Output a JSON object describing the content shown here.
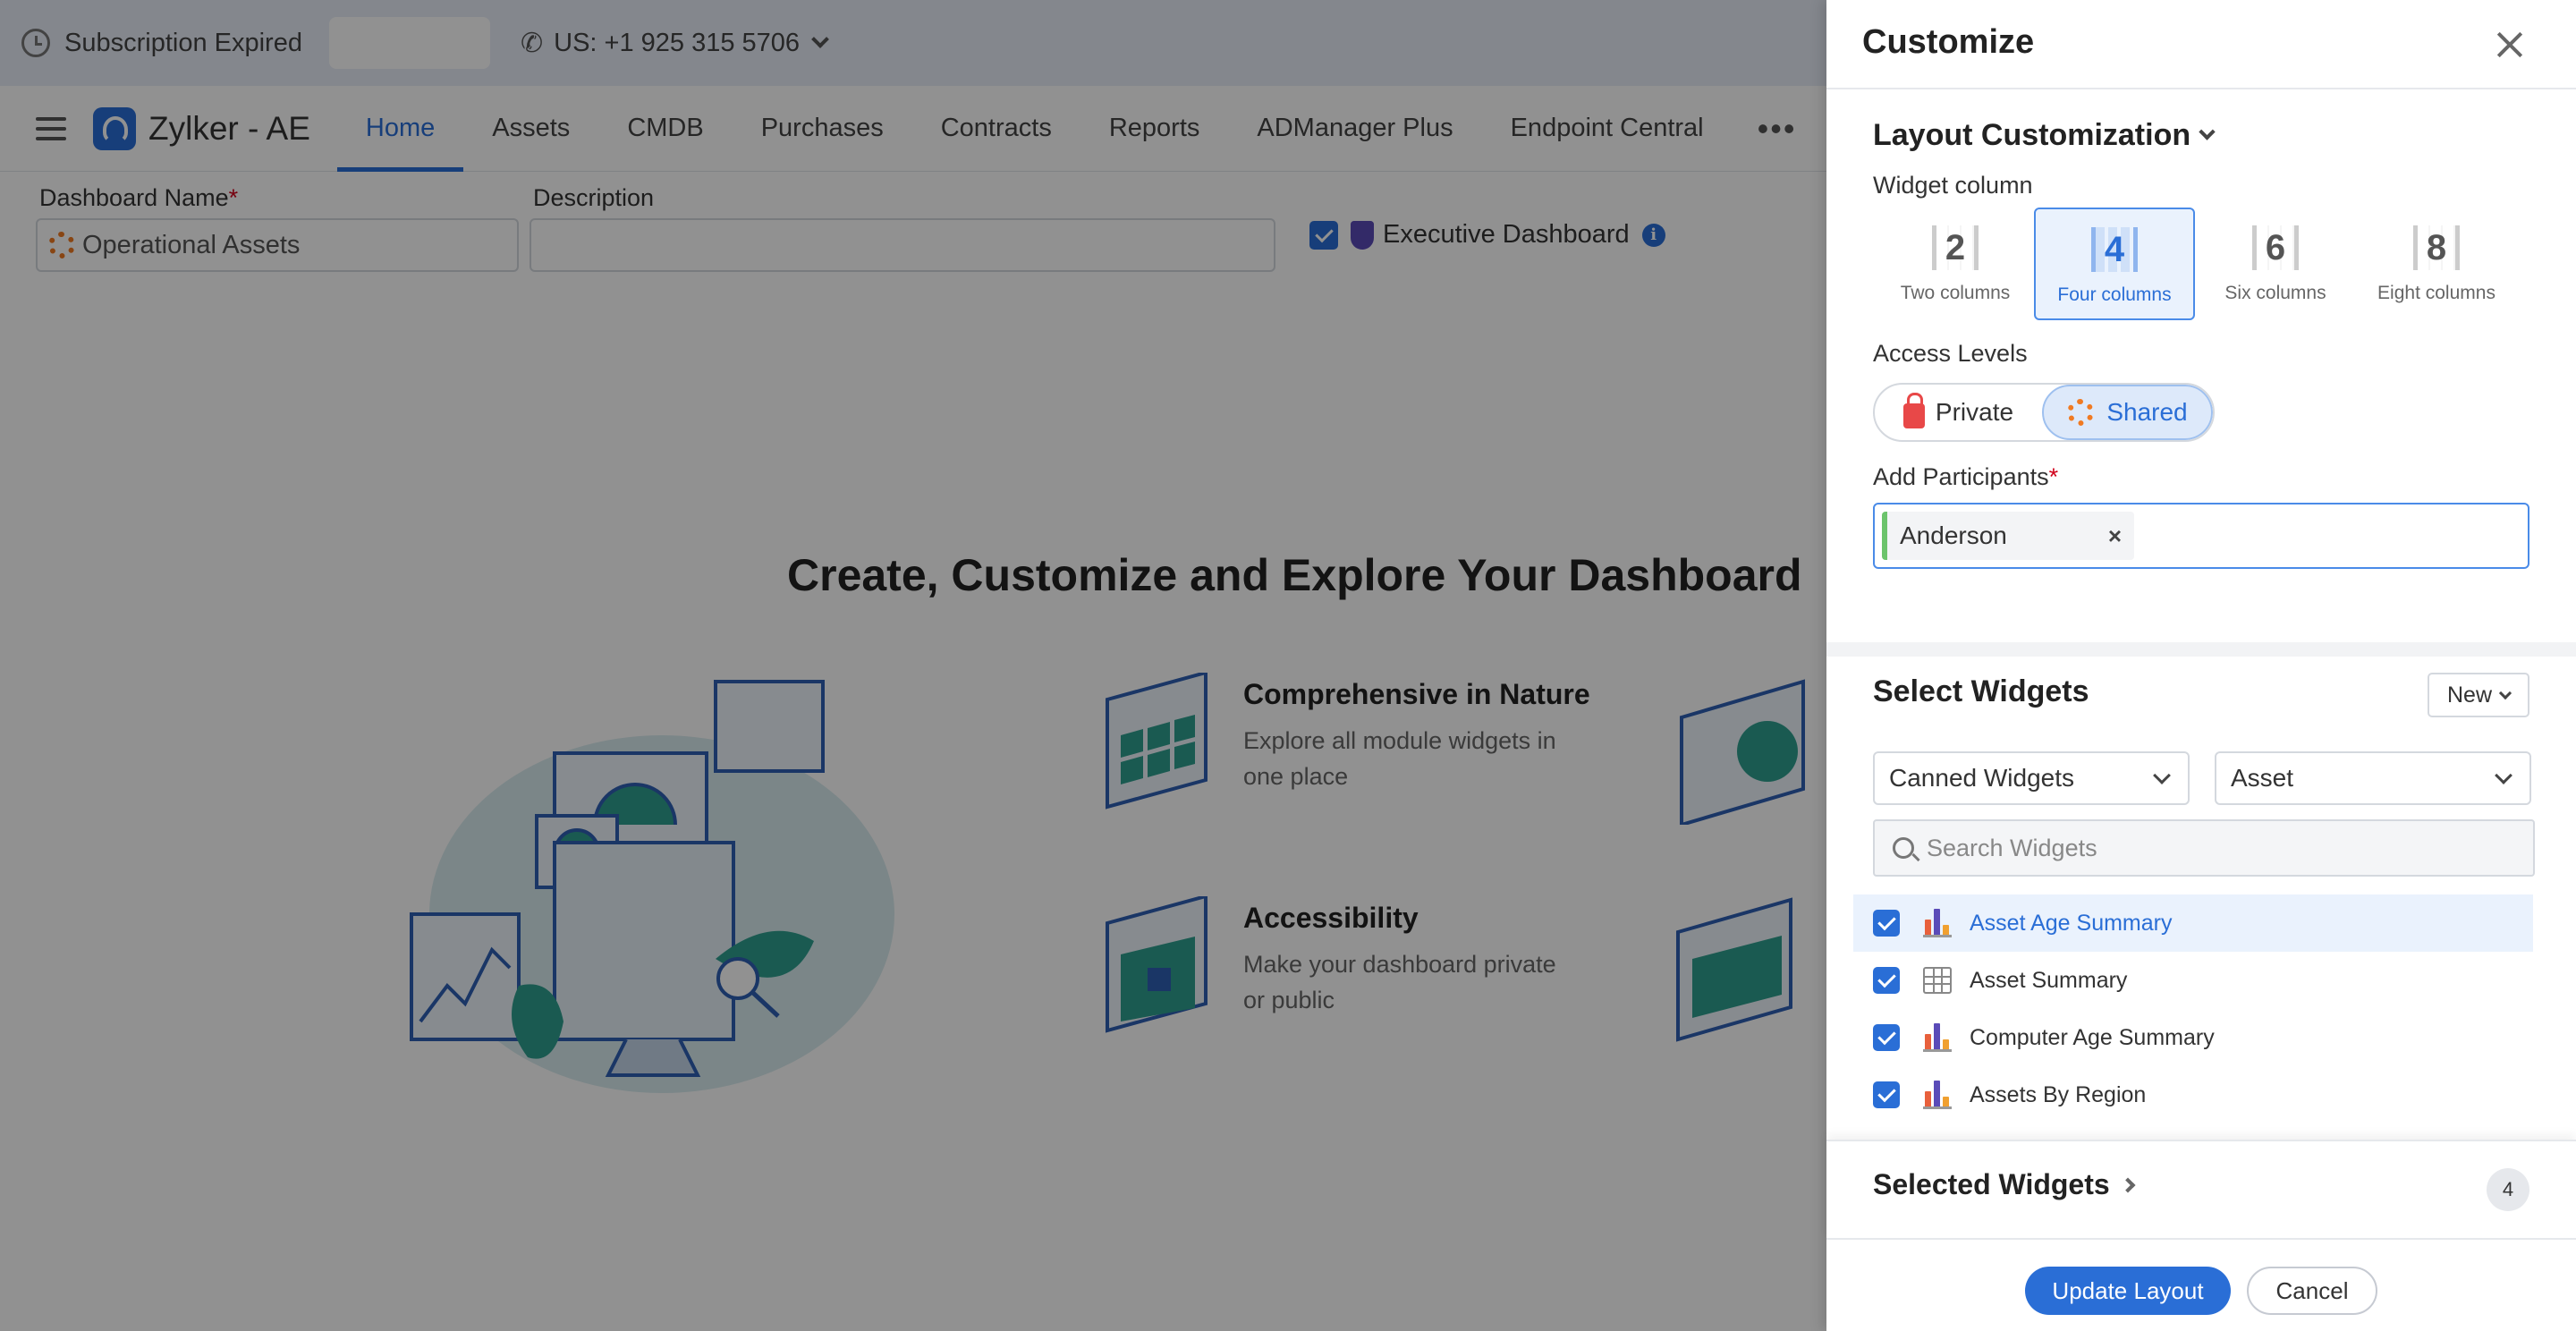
{
  "topbar": {
    "subscription": "Subscription Expired",
    "phone": "US: +1 925 315 5706"
  },
  "nav": {
    "brand": "Zylker - AE",
    "tabs": [
      "Home",
      "Assets",
      "CMDB",
      "Purchases",
      "Contracts",
      "Reports",
      "ADManager Plus",
      "Endpoint Central"
    ],
    "more": "•••"
  },
  "form": {
    "dashboard_name_label": "Dashboard Name",
    "dashboard_name_value": "Operational Assets",
    "description_label": "Description",
    "description_value": "",
    "executive_label": "Executive Dashboard",
    "required_mark": "*",
    "info_glyph": "i"
  },
  "main": {
    "headline": "Create, Customize and Explore Your Dashboard",
    "features": [
      {
        "title": "Comprehensive in Nature",
        "desc": "Explore all module widgets in one place"
      },
      {
        "title": "Accessibility",
        "desc": "Make your dashboard private or public"
      }
    ]
  },
  "panel": {
    "title": "Customize",
    "layout_title": "Layout Customization",
    "widget_column_label": "Widget column",
    "columns": [
      {
        "num": "2",
        "label": "Two columns",
        "selected": false
      },
      {
        "num": "4",
        "label": "Four columns",
        "selected": true
      },
      {
        "num": "6",
        "label": "Six columns",
        "selected": false
      },
      {
        "num": "8",
        "label": "Eight columns",
        "selected": false
      }
    ],
    "access_label": "Access Levels",
    "access_private": "Private",
    "access_shared": "Shared",
    "participants_label": "Add Participants",
    "participant_chip": "Anderson",
    "chip_remove": "×",
    "select_widgets_title": "Select Widgets",
    "new_button": "New",
    "widget_type": "Canned Widgets",
    "module": "Asset",
    "search_placeholder": "Search Widgets",
    "widgets": [
      {
        "label": "Asset Age Summary",
        "icon": "bar-chart-icon"
      },
      {
        "label": "Asset Summary",
        "icon": "table-icon"
      },
      {
        "label": "Computer Age Summary",
        "icon": "bar-chart-icon"
      },
      {
        "label": "Assets By Region",
        "icon": "bar-chart-icon"
      }
    ],
    "selected_widgets_title": "Selected Widgets",
    "selected_count": "4",
    "update_button": "Update Layout",
    "cancel_button": "Cancel"
  },
  "colors": {
    "accent": "#2a6ed6",
    "overlay": "#000000",
    "required": "#d0021b"
  }
}
